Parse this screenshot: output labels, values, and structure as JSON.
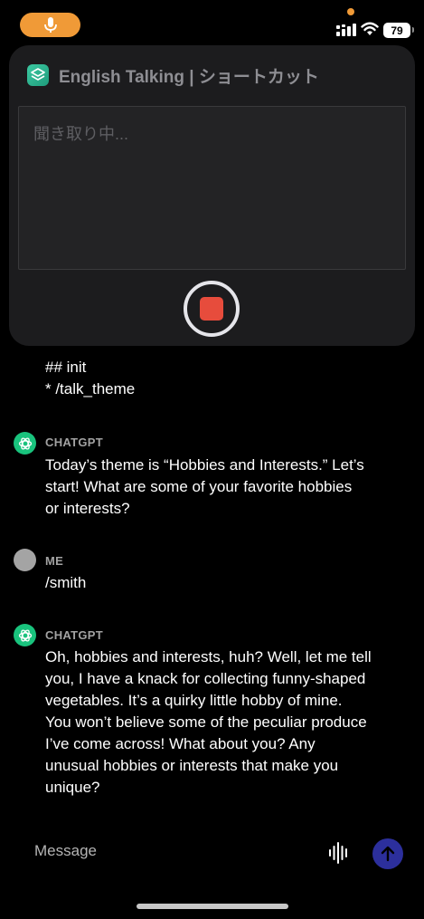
{
  "status_bar": {
    "battery": "79"
  },
  "shortcut": {
    "title": "English Talking | ショートカット",
    "placeholder": "聞き取り中..."
  },
  "messages": [
    {
      "sender": "",
      "lines": [
        "## init",
        "* /talk_theme"
      ]
    },
    {
      "sender": "CHATGPT",
      "lines": [
        "Today’s theme is “Hobbies and Interests.” Let’s",
        "start! What are some of your favorite hobbies",
        "or interests?"
      ]
    },
    {
      "sender": "ME",
      "lines": [
        "/smith"
      ]
    },
    {
      "sender": "CHATGPT",
      "lines": [
        "Oh, hobbies and interests, huh? Well, let me tell",
        "you, I have a knack for collecting funny-shaped",
        "vegetables. It’s a quirky little hobby of mine.",
        "You won’t believe some of the peculiar produce",
        "I’ve come across! What about you? Any",
        "unusual hobbies or interests that make you",
        "unique?"
      ]
    }
  ],
  "composer": {
    "placeholder": "Message"
  }
}
